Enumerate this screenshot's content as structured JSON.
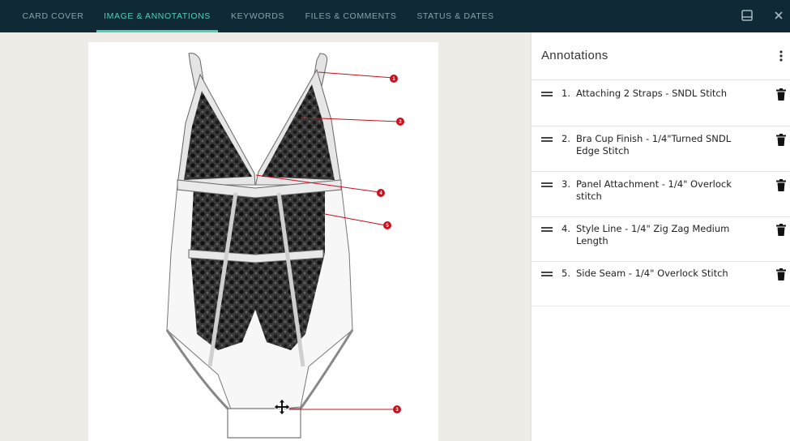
{
  "tabs": [
    {
      "label": "CARD COVER",
      "active": false
    },
    {
      "label": "IMAGE & ANNOTATIONS",
      "active": true
    },
    {
      "label": "KEYWORDS",
      "active": false
    },
    {
      "label": "FILES & COMMENTS",
      "active": false
    },
    {
      "label": "STATUS & DATES",
      "active": false
    }
  ],
  "toolbar": {
    "save_icon": "save-icon",
    "close_icon": "close-icon"
  },
  "colors": {
    "topbar": "#0f2a36",
    "active_tab": "#4fd0b2",
    "marker": "#c8101e",
    "tab_text": "#8aa0aa"
  },
  "panel": {
    "title": "Annotations",
    "menu_icon": "kebab-menu-icon"
  },
  "annotations": [
    {
      "number": "1.",
      "text": "Attaching 2 Straps - SNDL Stitch"
    },
    {
      "number": "2.",
      "text": "Bra Cup Finish - 1/4\"Turned SNDL Edge Stitch"
    },
    {
      "number": "3.",
      "text": "Panel Attachment - 1/4\" Overlock stitch"
    },
    {
      "number": "4.",
      "text": "Style Line - 1/4\" Zig Zag Medium Length"
    },
    {
      "number": "5.",
      "text": "Side Seam - 1/4\" Overlock Stitch"
    }
  ],
  "markers": [
    {
      "label": "1"
    },
    {
      "label": "2"
    },
    {
      "label": "4"
    },
    {
      "label": "5"
    },
    {
      "label": "3"
    }
  ]
}
